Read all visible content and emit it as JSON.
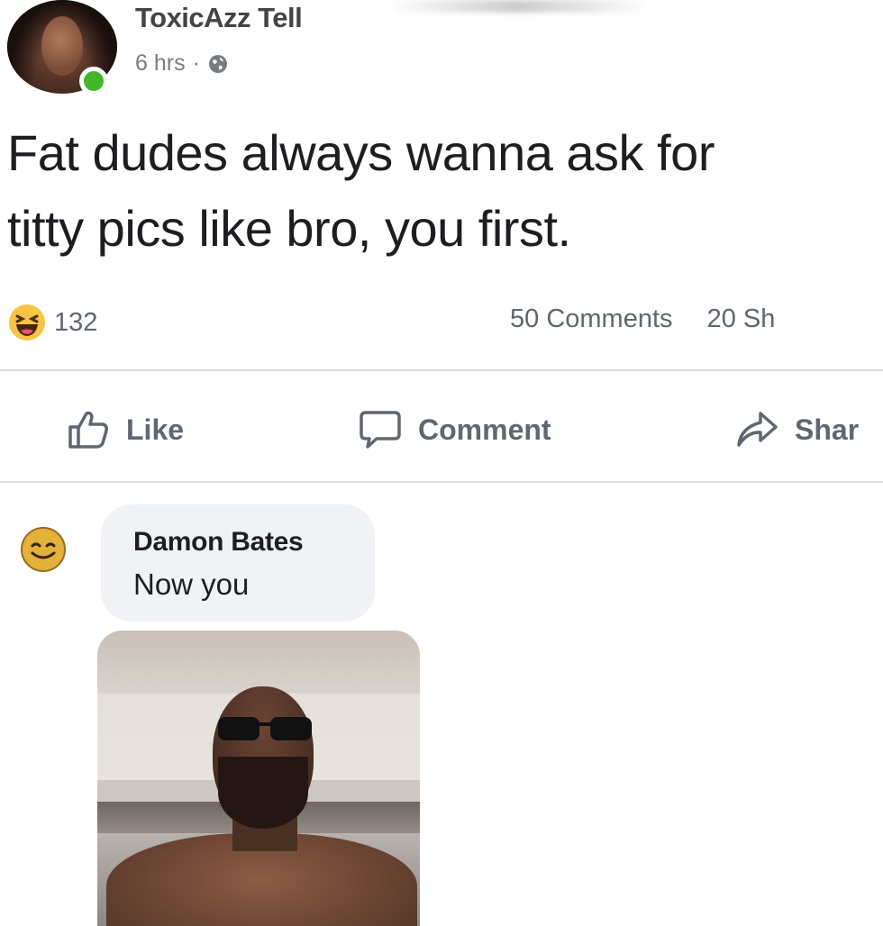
{
  "post": {
    "author": "ToxicAzz Tell",
    "time": "6 hrs",
    "separator": "·",
    "privacy_icon": "globe-icon",
    "text_line_1": "Fat dudes always wanna ask for",
    "text_line_2": "titty pics like bro, you first."
  },
  "stats": {
    "reaction_icon": "haha-icon",
    "reaction_count": "132",
    "comments": "50 Comments",
    "shares": "20 Sh"
  },
  "actions": {
    "like": "Like",
    "comment": "Comment",
    "share": "Shar"
  },
  "comment": {
    "author": "Damon Bates",
    "text": "Now you"
  },
  "colors": {
    "online": "#42b72a",
    "bubble": "#f0f2f5",
    "muted_text": "#606770",
    "divider": "#dcdde1"
  }
}
